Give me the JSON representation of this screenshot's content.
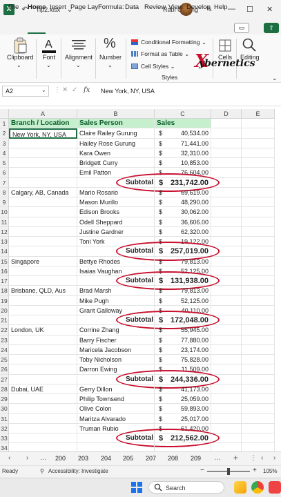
{
  "window": {
    "doc_title": "Tip2.xlsx",
    "user_name": "Rabi Gurung",
    "minimize": "—",
    "maximize": "☐",
    "close": "✕"
  },
  "menu": {
    "tabs": [
      "File",
      "Home",
      "Insert",
      "Page Lay",
      "Formula:",
      "Data",
      "Review",
      "View",
      "Develop",
      "Help"
    ],
    "active": "Home"
  },
  "ribbon": {
    "clipboard": "Clipboard",
    "font": "Font",
    "alignment": "Alignment",
    "number": "Number",
    "conditional_formatting": "Conditional Formatting",
    "format_as_table": "Format as Table",
    "cell_styles": "Cell Styles",
    "styles_group": "Styles",
    "cells": "Cells",
    "editing": "Editing",
    "watermark": "ybernetics"
  },
  "formula_bar": {
    "name_box": "A2",
    "fx": "fx",
    "formula": "New York, NY, USA"
  },
  "columns": [
    "A",
    "B",
    "C",
    "D",
    "E"
  ],
  "headers": {
    "branch": "Branch / Location",
    "sales_person": "Sales Person",
    "sales": "Sales"
  },
  "currency": "$",
  "subtotal_label": "Subtotal",
  "rows": [
    {
      "n": "1"
    },
    {
      "n": "2",
      "branch": "New York, NY, USA",
      "person": "Claire Railey Gurung",
      "amount": "40,534.00"
    },
    {
      "n": "3",
      "person": "Hailey Rose Gurung",
      "amount": "71,441.00"
    },
    {
      "n": "4",
      "person": "Kara Owen",
      "amount": "32,310.00"
    },
    {
      "n": "5",
      "person": "Bridgett Curry",
      "amount": "10,853.00"
    },
    {
      "n": "6",
      "person": "Emil Patton",
      "amount": "76,604.00"
    },
    {
      "n": "7",
      "subtotal": "231,742.00"
    },
    {
      "n": "8",
      "branch": "Calgary, AB, Canada",
      "person": "Mario Rosario",
      "amount": "69,619.00"
    },
    {
      "n": "9",
      "person": "Mason Murillo",
      "amount": "48,290.00"
    },
    {
      "n": "10",
      "person": "Edison Brooks",
      "amount": "30,062.00"
    },
    {
      "n": "11",
      "person": "Odell Sheppard",
      "amount": "36,606.00"
    },
    {
      "n": "12",
      "person": "Justine Gardner",
      "amount": "62,320.00"
    },
    {
      "n": "13",
      "person": "Toni York",
      "amount": "19,122.00"
    },
    {
      "n": "14",
      "subtotal": "257,019.00"
    },
    {
      "n": "15",
      "branch": "Singapore",
      "person": "Bettye Rhodes",
      "amount": "79,813.00"
    },
    {
      "n": "16",
      "person": "Isaias Vaughan",
      "amount": "52,125.00"
    },
    {
      "n": "17",
      "subtotal": "131,938.00"
    },
    {
      "n": "18",
      "branch": "Brisbane, QLD, Aus",
      "person": "Brad Marsh",
      "amount": "79,813.00"
    },
    {
      "n": "19",
      "person": "Mike Pugh",
      "amount": "52,125.00"
    },
    {
      "n": "20",
      "person": "Grant Galloway",
      "amount": "40,110.00"
    },
    {
      "n": "21",
      "subtotal": "172,048.00"
    },
    {
      "n": "22",
      "branch": "London, UK",
      "person": "Corrine Zhang",
      "amount": "55,945.00"
    },
    {
      "n": "23",
      "person": "Barry Fischer",
      "amount": "77,880.00"
    },
    {
      "n": "24",
      "person": "Maricela Jacobson",
      "amount": "23,174.00"
    },
    {
      "n": "25",
      "person": "Toby Nicholson",
      "amount": "75,828.00"
    },
    {
      "n": "26",
      "person": "Darron Ewing",
      "amount": "11,509.00"
    },
    {
      "n": "27",
      "subtotal": "244,336.00"
    },
    {
      "n": "28",
      "branch": "Dubai, UAE",
      "person": "Gerry Dillon",
      "amount": "41,173.00"
    },
    {
      "n": "29",
      "person": "Philip Townsend",
      "amount": "25,059.00"
    },
    {
      "n": "30",
      "person": "Olive Colon",
      "amount": "59,893.00"
    },
    {
      "n": "31",
      "person": "Maritza Alvarado",
      "amount": "25,017.00"
    },
    {
      "n": "32",
      "person": "Truman Rubio",
      "amount": "61,420.00"
    },
    {
      "n": "33",
      "subtotal": "212,562.00"
    },
    {
      "n": "34"
    }
  ],
  "sheet_tabs": [
    "200",
    "203",
    "204",
    "205",
    "207",
    "208",
    "209"
  ],
  "status": {
    "ready": "Ready",
    "accessibility": "Accessibility: Investigate",
    "zoom": "105%"
  },
  "taskbar": {
    "search": "Search"
  }
}
